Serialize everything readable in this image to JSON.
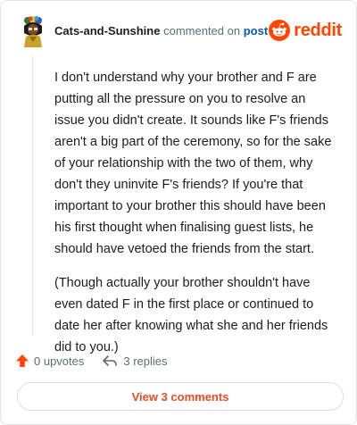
{
  "header": {
    "username": "Cats-and-Sunshine",
    "action_text": "commented on",
    "post_link": "post",
    "logo_text": "reddit"
  },
  "comment": {
    "paragraphs": [
      "I don't understand why your brother and F are putting all the pressure on you to resolve an issue you didn't create. It sounds like F's friends aren't a big part of the ceremony, so for the sake of your relationship with the two of them, why don't they uninvite F's friends? If you're that important to your brother this should have been his first thought when finalising guest lists, he should have vetoed the friends from the start.",
      "(Though actually your brother shouldn't have even dated F in the first place or continued to date her after knowing what she and her friends did to you.)"
    ]
  },
  "actions": {
    "upvotes": "0 upvotes",
    "replies": "3 replies"
  },
  "view_comments_label": "View 3 comments",
  "colors": {
    "brand": "#ff4500",
    "link": "#0a57b5",
    "muted": "#576f76"
  }
}
